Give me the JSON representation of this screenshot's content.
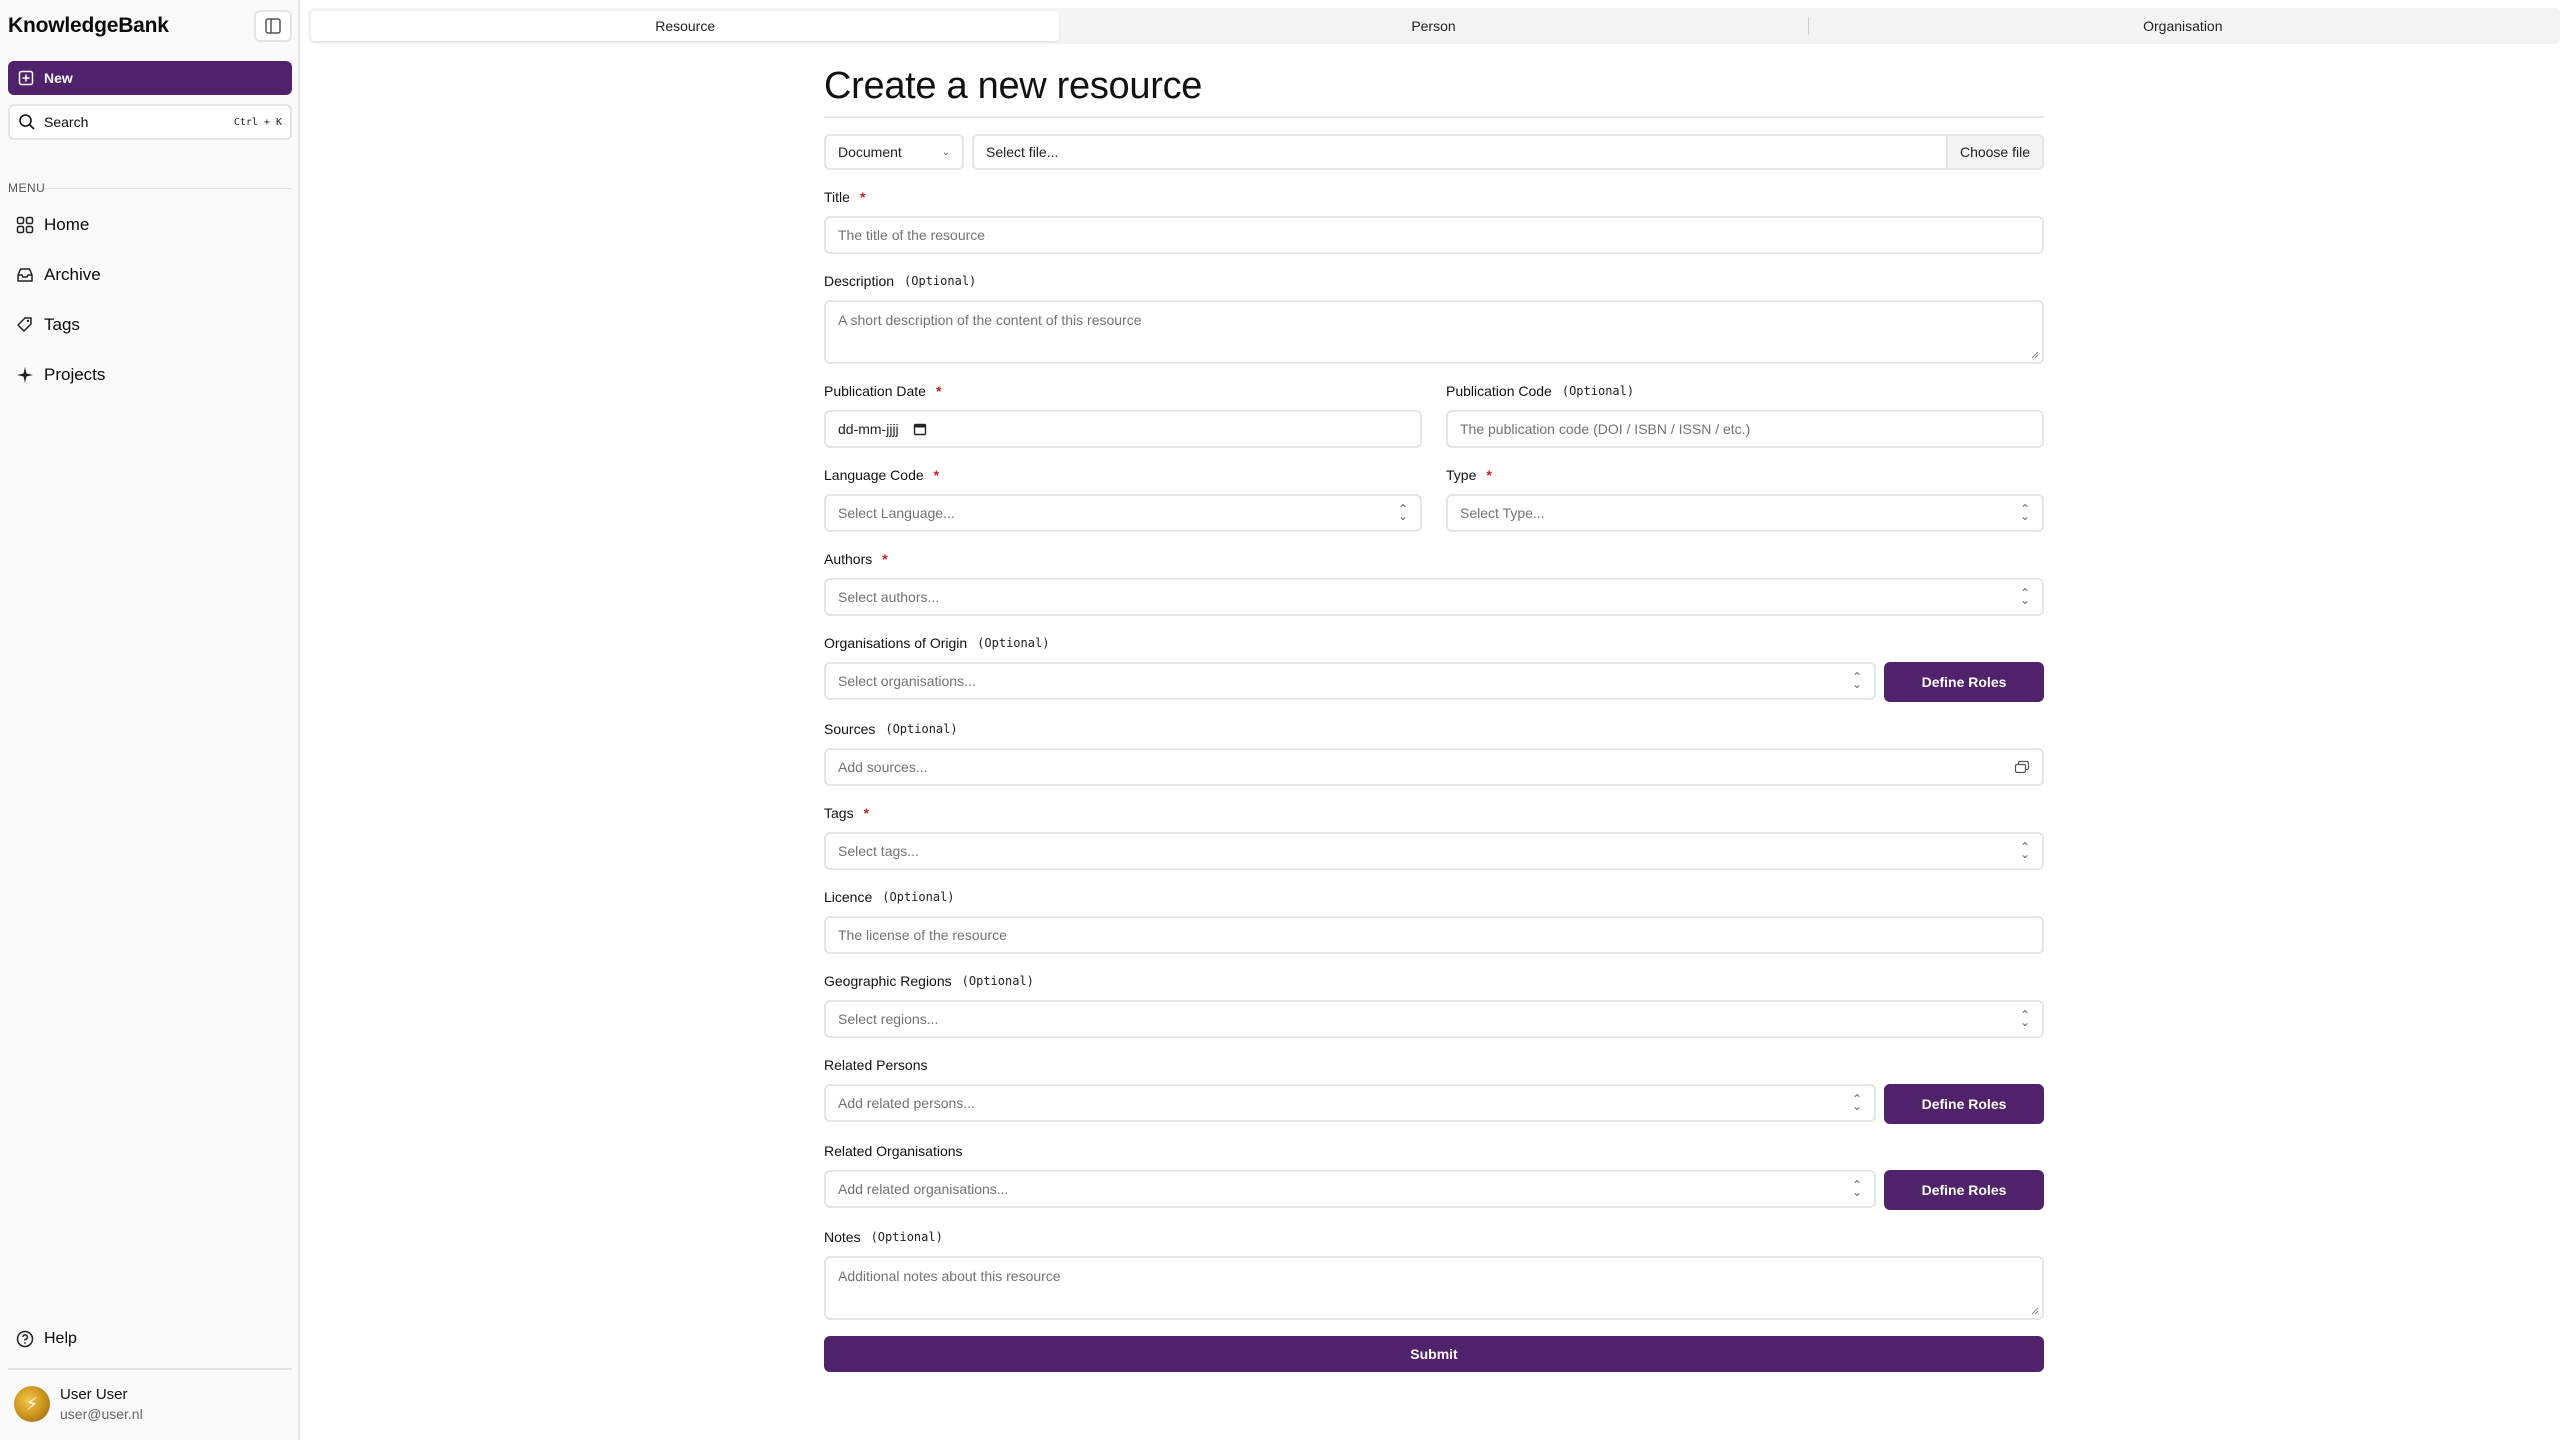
{
  "sidebar": {
    "brand": "KnowledgeBank",
    "new_label": "New",
    "search_label": "Search",
    "search_shortcut": "Ctrl + K",
    "menu_label": "MENU",
    "items": [
      {
        "label": "Home",
        "icon": "grid-icon"
      },
      {
        "label": "Archive",
        "icon": "inbox-icon"
      },
      {
        "label": "Tags",
        "icon": "tag-icon"
      },
      {
        "label": "Projects",
        "icon": "sparkle-icon"
      }
    ],
    "help_label": "Help",
    "user": {
      "name": "User User",
      "email": "user@user.nl"
    }
  },
  "tabs": [
    {
      "label": "Resource",
      "active": true
    },
    {
      "label": "Person",
      "active": false
    },
    {
      "label": "Organisation",
      "active": false
    }
  ],
  "form": {
    "title": "Create a new resource",
    "doc_type": "Document",
    "file_placeholder": "Select file...",
    "file_button": "Choose file",
    "required_mark": "*",
    "optional_mark": "(Optional)",
    "fields": {
      "title": {
        "label": "Title",
        "placeholder": "The title of the resource"
      },
      "description": {
        "label": "Description",
        "placeholder": "A short description of the content of this resource"
      },
      "publication_date": {
        "label": "Publication Date",
        "value": "dd-mm-jjjj"
      },
      "publication_code": {
        "label": "Publication Code",
        "placeholder": "The publication code (DOI / ISBN / ISSN / etc.)"
      },
      "language": {
        "label": "Language Code",
        "placeholder": "Select Language..."
      },
      "type": {
        "label": "Type",
        "placeholder": "Select Type..."
      },
      "authors": {
        "label": "Authors",
        "placeholder": "Select authors..."
      },
      "orgs_origin": {
        "label": "Organisations of Origin",
        "placeholder": "Select organisations..."
      },
      "sources": {
        "label": "Sources",
        "placeholder": "Add sources..."
      },
      "tags": {
        "label": "Tags",
        "placeholder": "Select tags..."
      },
      "licence": {
        "label": "Licence",
        "placeholder": "The license of the resource"
      },
      "regions": {
        "label": "Geographic Regions",
        "placeholder": "Select regions..."
      },
      "related_persons": {
        "label": "Related Persons",
        "placeholder": "Add related persons..."
      },
      "related_orgs": {
        "label": "Related Organisations",
        "placeholder": "Add related organisations..."
      },
      "notes": {
        "label": "Notes",
        "placeholder": "Additional notes about this resource"
      }
    },
    "define_roles": "Define Roles",
    "submit": "Submit"
  },
  "colors": {
    "accent": "#50226b",
    "required": "#d21f1f",
    "border": "#e5e5e5"
  }
}
